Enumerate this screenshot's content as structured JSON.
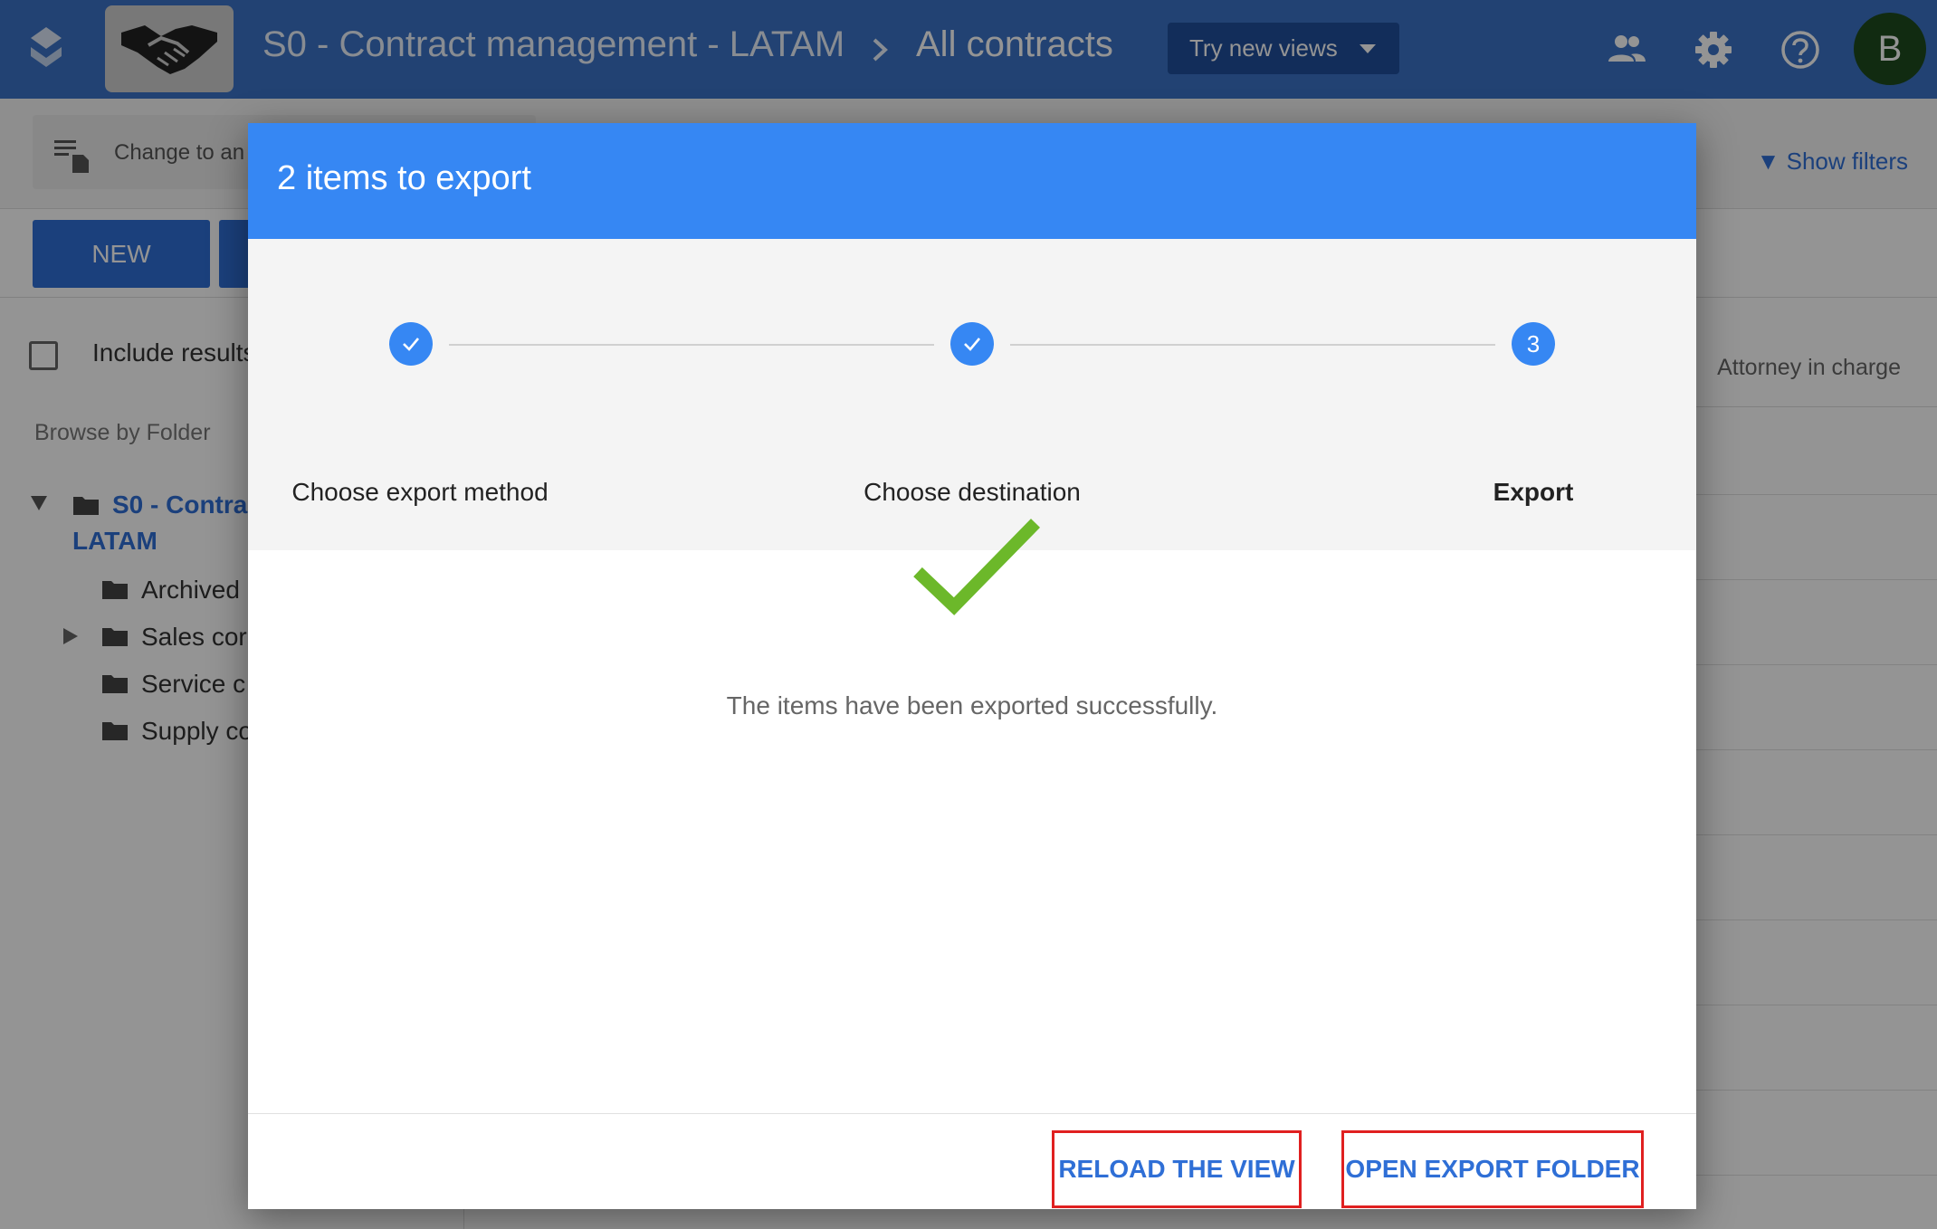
{
  "header": {
    "project_name": "S0 - Contract management - LATAM",
    "current_view": "All contracts",
    "try_new_views": "Try new views",
    "avatar_initial": "B",
    "icons": [
      "app-logo-icon",
      "users-icon",
      "gear-icon",
      "help-icon"
    ],
    "color": "#3b73c6"
  },
  "toolbar": {
    "view_switch_label": "Change to an",
    "show_filters": "▼ Show filters"
  },
  "actions": {
    "new_label": "NEW"
  },
  "left_panel": {
    "include_results_label": "Include results",
    "browse_label": "Browse by Folder",
    "root_folder_line1": "S0 - Contra",
    "root_folder_line2": "LATAM",
    "folders": [
      "Archived",
      "Sales cor",
      "Service c",
      "Supply co"
    ]
  },
  "grid": {
    "column_attorney": "Attorney in charge"
  },
  "modal": {
    "title": "2 items to export",
    "steps": [
      {
        "label": "Choose export method",
        "state": "done"
      },
      {
        "label": "Choose destination",
        "state": "done"
      },
      {
        "label": "Export",
        "number": "3",
        "state": "active"
      }
    ],
    "success_message": "The items have been exported successfully.",
    "buttons": {
      "reload": "RELOAD THE VIEW",
      "open_folder": "OPEN EXPORT FOLDER"
    },
    "colors": {
      "accent": "#3687f3",
      "success": "#6cb82a",
      "highlight": "#e02020"
    }
  }
}
